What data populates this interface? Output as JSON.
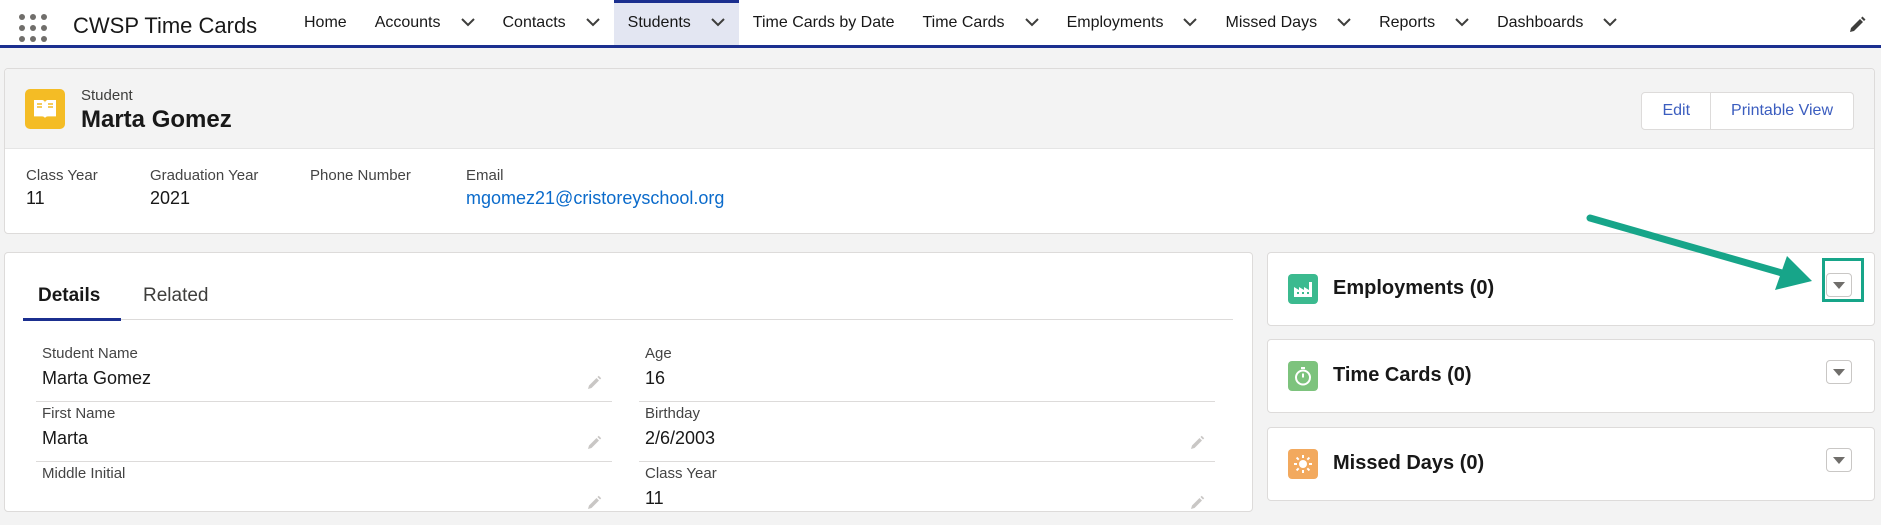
{
  "nav": {
    "app_name": "CWSP Time Cards",
    "tabs": [
      {
        "label": "Home",
        "has_menu": false
      },
      {
        "label": "Accounts",
        "has_menu": true
      },
      {
        "label": "Contacts",
        "has_menu": true
      },
      {
        "label": "Students",
        "has_menu": true,
        "active": true
      },
      {
        "label": "Time Cards by Date",
        "has_menu": false
      },
      {
        "label": "Time Cards",
        "has_menu": true
      },
      {
        "label": "Employments",
        "has_menu": true
      },
      {
        "label": "Missed Days",
        "has_menu": true
      },
      {
        "label": "Reports",
        "has_menu": true
      },
      {
        "label": "Dashboards",
        "has_menu": true
      }
    ]
  },
  "record": {
    "object_label": "Student",
    "name": "Marta Gomez",
    "buttons": {
      "edit": "Edit",
      "printable_view": "Printable View"
    },
    "highlights": [
      {
        "label": "Class Year",
        "value": "11"
      },
      {
        "label": "Graduation Year",
        "value": "2021"
      },
      {
        "label": "Phone Number",
        "value": ""
      },
      {
        "label": "Email",
        "value": "mgomez21@cristoreyschool.org"
      }
    ]
  },
  "details": {
    "tabs": [
      "Details",
      "Related"
    ],
    "fields_left": [
      {
        "label": "Student Name",
        "value": "Marta Gomez"
      },
      {
        "label": "First Name",
        "value": "Marta"
      },
      {
        "label": "Middle Initial",
        "value": ""
      }
    ],
    "fields_right": [
      {
        "label": "Age",
        "value": "16"
      },
      {
        "label": "Birthday",
        "value": "2/6/2003"
      },
      {
        "label": "Class Year",
        "value": "11"
      }
    ]
  },
  "related": [
    {
      "title": "Employments (0)",
      "icon": "factory-icon",
      "color": "#3bba8f"
    },
    {
      "title": "Time Cards (0)",
      "icon": "stopwatch-icon",
      "color": "#7dc37d"
    },
    {
      "title": "Missed Days (0)",
      "icon": "sun-icon",
      "color": "#f2a95e"
    }
  ],
  "colors": {
    "accent": "#1b2f8f",
    "link": "#0b6bcb",
    "annotation": "#17a589",
    "student_icon": "#f4bc25"
  }
}
